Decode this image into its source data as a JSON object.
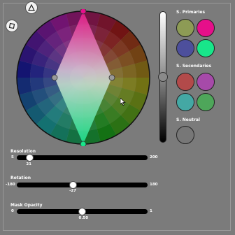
{
  "tools": {
    "triangle_icon": "triangle-icon",
    "square_icon": "square-icon"
  },
  "wheel": {
    "hue_segments": 24,
    "ring_count": 5,
    "selection_shape": "diamond"
  },
  "value_slider": {
    "level": 0.5
  },
  "primaries": {
    "label": "S. Primaries",
    "swatches": [
      {
        "name": "olive",
        "color": "#8d9b55"
      },
      {
        "name": "magenta",
        "color": "#e60f8a"
      },
      {
        "name": "indigo",
        "color": "#4d4f9c"
      },
      {
        "name": "spring-green",
        "color": "#18e68a"
      }
    ]
  },
  "secondaries": {
    "label": "S. Secondaries",
    "swatches": [
      {
        "name": "brick-red",
        "color": "#b24a4a"
      },
      {
        "name": "violet",
        "color": "#a64aa9"
      },
      {
        "name": "teal",
        "color": "#44a8a4"
      },
      {
        "name": "green",
        "color": "#4ea65a"
      }
    ]
  },
  "neutral": {
    "label": "S. Neutral",
    "color": "#777777"
  },
  "resolution": {
    "label": "Resolution",
    "min": "5",
    "max": "200",
    "value": "21",
    "level": 0.08
  },
  "rotation": {
    "label": "Rotation",
    "min": "-180",
    "max": "180",
    "value": "-27",
    "level": 0.425
  },
  "mask_opacity": {
    "label": "Mask Opacity",
    "min": "0",
    "max": "1",
    "value": "0.50",
    "level": 0.5
  }
}
